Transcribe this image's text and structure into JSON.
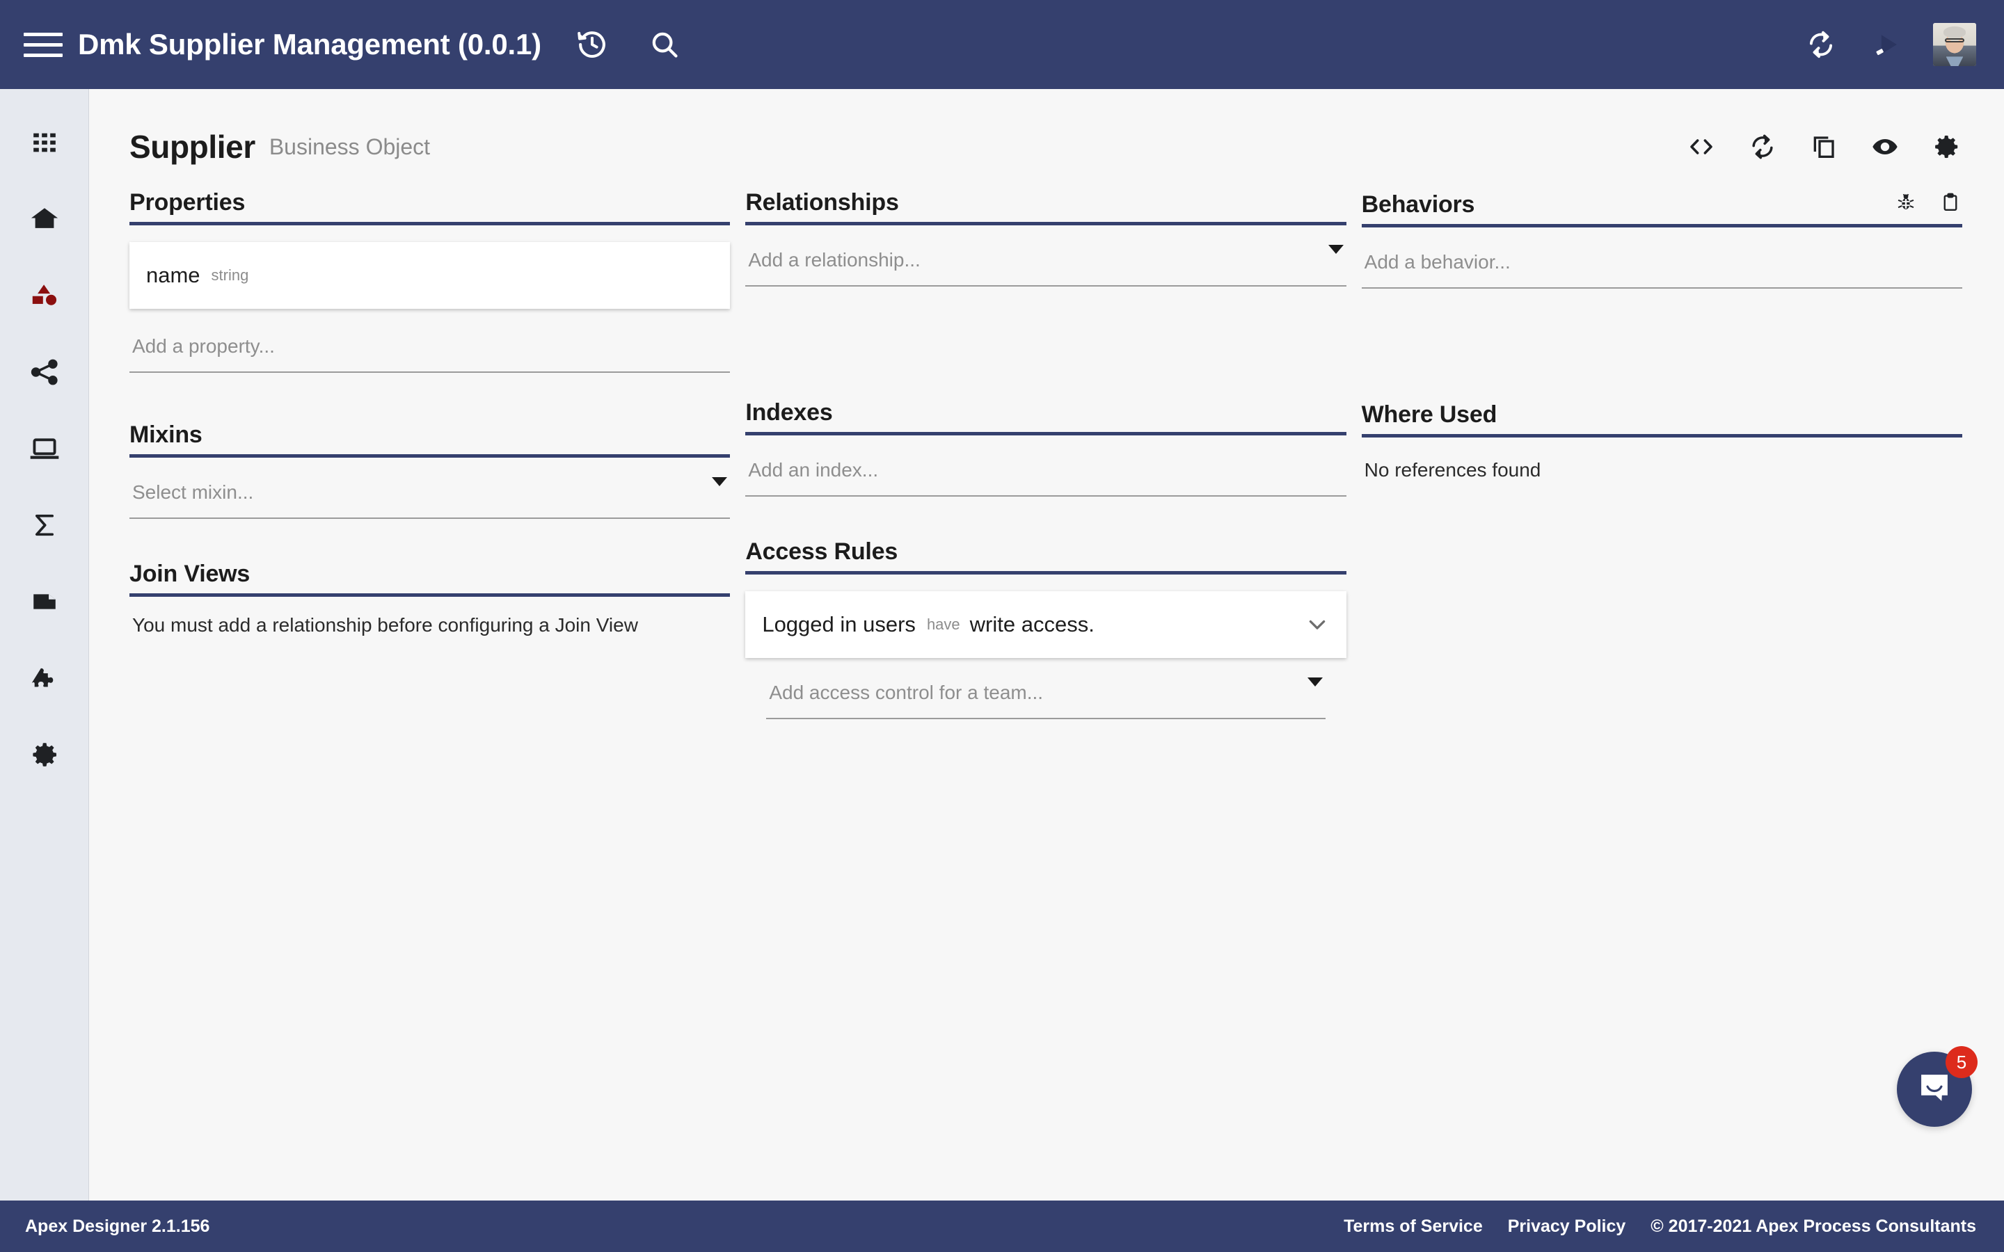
{
  "topbar": {
    "menu_label": "menu",
    "title": "Dmk Supplier Management (0.0.1)",
    "history_icon": "history-icon",
    "search_icon": "search-icon",
    "sync_icon": "sync-icon",
    "run_icon": "run-icon",
    "avatar_label": "user-avatar"
  },
  "rail": {
    "items": [
      {
        "name": "apps-grid-icon",
        "label": "Apps"
      },
      {
        "name": "home-icon",
        "label": "Home"
      },
      {
        "name": "business-objects-icon",
        "label": "Business Objects",
        "active": true
      },
      {
        "name": "share-icon",
        "label": "Integrations"
      },
      {
        "name": "laptop-icon",
        "label": "Pages"
      },
      {
        "name": "sigma-icon",
        "label": "Functions"
      },
      {
        "name": "file-icon",
        "label": "Documents"
      },
      {
        "name": "puzzle-icon",
        "label": "Plugins"
      },
      {
        "name": "gear-icon",
        "label": "Settings"
      }
    ]
  },
  "page": {
    "title": "Supplier",
    "subtitle": "Business Object",
    "actions": [
      {
        "name": "code-icon",
        "label": "View Code"
      },
      {
        "name": "refresh-icon",
        "label": "Refresh"
      },
      {
        "name": "copy-icon",
        "label": "Duplicate"
      },
      {
        "name": "eye-icon",
        "label": "Preview"
      },
      {
        "name": "gear-icon",
        "label": "Settings"
      }
    ]
  },
  "sections": {
    "properties": {
      "title": "Properties",
      "items": [
        {
          "name": "name",
          "type": "string"
        }
      ],
      "add_placeholder": "Add a property..."
    },
    "mixins": {
      "title": "Mixins",
      "select_placeholder": "Select mixin..."
    },
    "join_views": {
      "title": "Join Views",
      "empty_message": "You must add a relationship before configuring a Join View"
    },
    "relationships": {
      "title": "Relationships",
      "add_placeholder": "Add a relationship..."
    },
    "indexes": {
      "title": "Indexes",
      "add_placeholder": "Add an index..."
    },
    "access_rules": {
      "title": "Access Rules",
      "rules": [
        {
          "subject": "Logged in users",
          "verb": "have",
          "predicate": "write access."
        }
      ],
      "add_placeholder": "Add access control for a team..."
    },
    "behaviors": {
      "title": "Behaviors",
      "add_placeholder": "Add a behavior...",
      "icons": [
        {
          "name": "bug-icon",
          "label": "Debug"
        },
        {
          "name": "clipboard-icon",
          "label": "Logs"
        }
      ]
    },
    "where_used": {
      "title": "Where Used",
      "empty_message": "No references found"
    }
  },
  "footer": {
    "version": "Apex Designer 2.1.156",
    "terms": "Terms of Service",
    "privacy": "Privacy Policy",
    "copyright": "© 2017-2021 Apex Process Consultants"
  },
  "intercom": {
    "badge_count": "5",
    "icon": "chat-bubble-icon"
  },
  "colors": {
    "brand_navy": "#35406e",
    "accent_red": "#8b0f0f",
    "badge_red": "#dd2b1c",
    "page_bg": "#f7f7f7",
    "rail_bg": "#e6e9ef"
  }
}
